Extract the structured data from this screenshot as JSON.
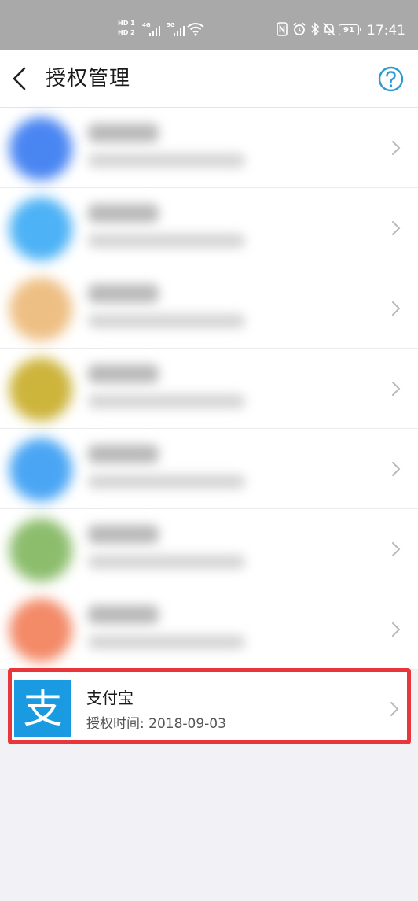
{
  "status_bar": {
    "sim1": "HD 1",
    "sim2": "HD 2",
    "net1": "4G",
    "net2": "5G",
    "battery": "91",
    "time": "17:41",
    "icons": [
      "nfc-icon",
      "alarm-icon",
      "bluetooth-icon",
      "mute-icon",
      "battery-icon",
      "wifi-icon",
      "signal-icon"
    ]
  },
  "header": {
    "title": "授权管理",
    "back_icon": "chevron-left-icon",
    "help_icon": "question-circle-icon"
  },
  "colors": {
    "accent": "#2e9ad3",
    "highlight_border": "#e8363b",
    "alipay_blue": "#1a9be1"
  },
  "authorized_apps": [
    {
      "avatar_color": "#4a86f2"
    },
    {
      "avatar_color": "#4db2f6"
    },
    {
      "avatar_color": "#eebf84"
    },
    {
      "avatar_color": "#cdb43b"
    },
    {
      "avatar_color": "#4aa6f4"
    },
    {
      "avatar_color": "#8cbd6c"
    },
    {
      "avatar_color": "#f38a68"
    }
  ],
  "highlighted_app": {
    "logo_glyph": "支",
    "name": "支付宝",
    "auth_time": "授权时间: 2018-09-03"
  }
}
